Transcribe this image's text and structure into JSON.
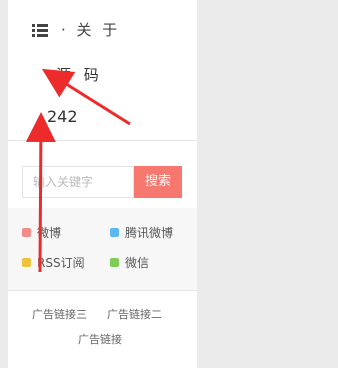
{
  "header": {
    "menu_icon": "list-icon",
    "about_label": "· 关 于"
  },
  "nav": {
    "source_label": "源 码",
    "count": "242"
  },
  "search": {
    "placeholder": "输入关键字",
    "button_label": "搜索"
  },
  "social": [
    {
      "label": "微博",
      "color": "#f58b87"
    },
    {
      "label": "腾讯微博",
      "color": "#5cb8f3"
    },
    {
      "label": "RSS订阅",
      "color": "#f0c23a"
    },
    {
      "label": "微信",
      "color": "#7ccf54"
    }
  ],
  "ads": {
    "link1": "广告链接三",
    "link2": "广告链接二",
    "link3": "广告链接"
  },
  "colors": {
    "accent": "#f6786f",
    "arrow": "#ee2b2b"
  }
}
